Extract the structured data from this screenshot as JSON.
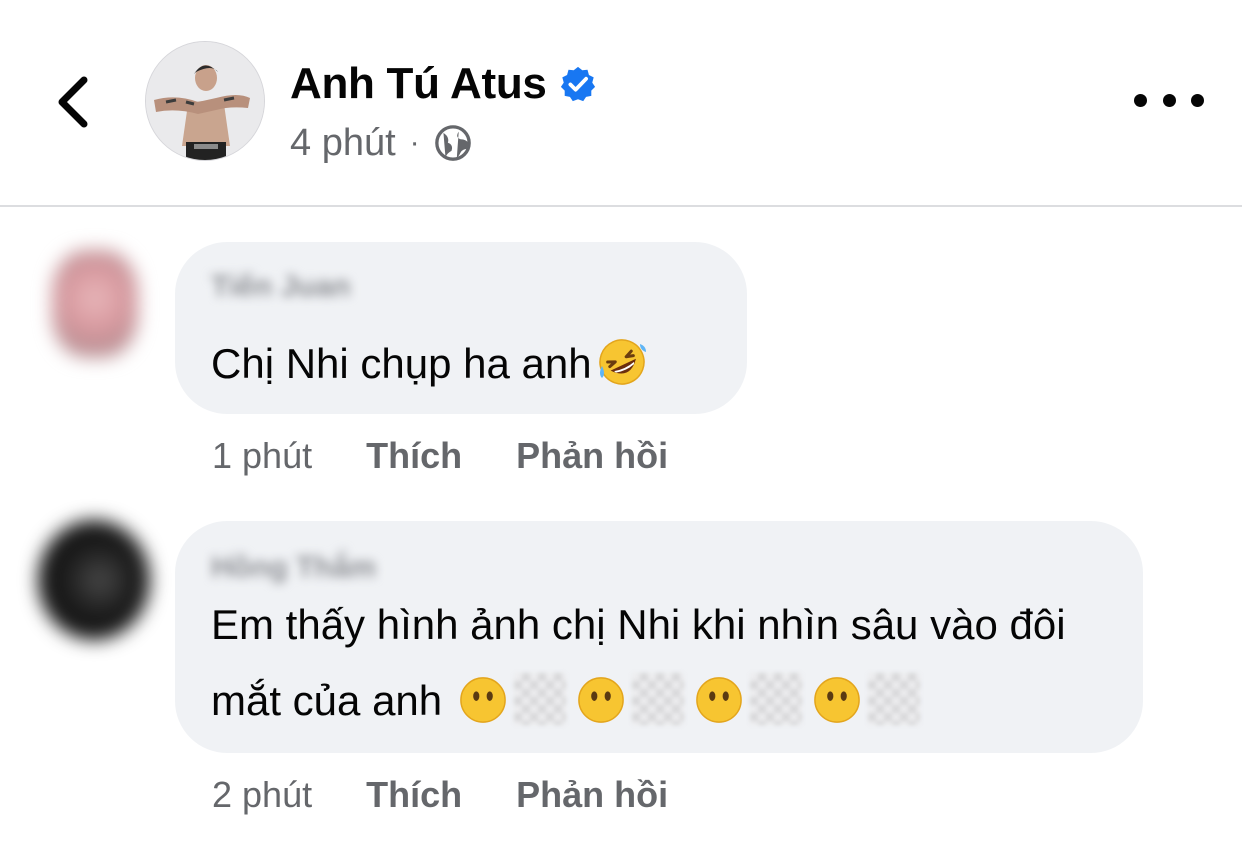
{
  "header": {
    "poster_name": "Anh Tú Atus",
    "verified_icon": "verified-badge-icon",
    "time": "4 phút",
    "separator": "·",
    "audience_icon": "globe-icon",
    "back_icon": "chevron-left-icon",
    "more_icon": "more-horizontal-icon"
  },
  "colors": {
    "bubble": "#f0f2f5",
    "meta_text": "#65676b",
    "verified": "#1877f2",
    "text": "#050505"
  },
  "comments": [
    {
      "name": "Tiến Juan",
      "text": "Chị Nhi chụp ha anh",
      "emoji": "rolling-on-floor-laughing-emoji",
      "time": "1 phút",
      "like": "Thích",
      "reply": "Phản hồi"
    },
    {
      "name": "Hồng Thắm",
      "text": "Em thấy hình ảnh chị Nhi khi nhìn sâu vào đôi mắt của anh",
      "emoji": "face-without-mouth-emoji",
      "time": "2 phút",
      "like": "Thích",
      "reply": "Phản hồi"
    }
  ]
}
